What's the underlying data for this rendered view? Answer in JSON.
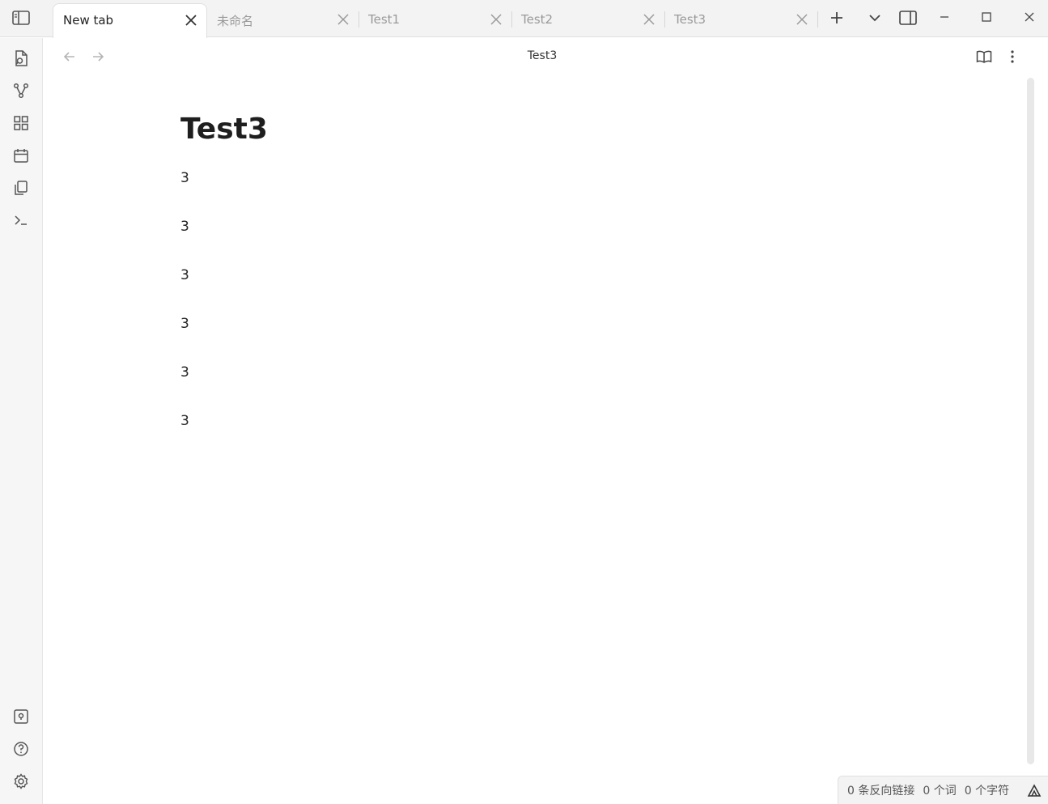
{
  "tabs": [
    {
      "label": "New tab",
      "active": true
    },
    {
      "label": "未命名",
      "active": false
    },
    {
      "label": "Test1",
      "active": false
    },
    {
      "label": "Test2",
      "active": false
    },
    {
      "label": "Test3",
      "active": false
    }
  ],
  "titlebar_icons": [
    "sidebar-toggle-icon",
    "new-tab-icon",
    "tab-list-chevron-icon",
    "right-sidebar-toggle-icon",
    "minimize-icon",
    "maximize-icon",
    "close-window-icon"
  ],
  "ribbon": {
    "top": [
      "quick-switcher-icon",
      "graph-view-icon",
      "canvas-icon",
      "daily-note-icon",
      "templates-icon",
      "command-palette-icon"
    ],
    "bottom": [
      "vault-switch-icon",
      "help-icon",
      "settings-icon"
    ]
  },
  "view": {
    "title": "Test3",
    "nav": [
      "back-arrow-icon",
      "forward-arrow-icon"
    ],
    "actions": [
      "reading-view-icon",
      "more-options-icon"
    ]
  },
  "note": {
    "heading": "Test3",
    "paragraphs": [
      "3",
      "3",
      "3",
      "3",
      "3",
      "3"
    ]
  },
  "statusbar": {
    "backlinks": "0 条反向链接",
    "words": "0 个词",
    "chars": "0 个字符",
    "sync_icon": "sync-status-icon"
  },
  "colors": {
    "tabbar_bg": "#f3f3f3",
    "ribbon_bg": "#f6f6f6",
    "content_bg": "#ffffff",
    "text": "#222222",
    "muted": "#9a9a9a"
  }
}
